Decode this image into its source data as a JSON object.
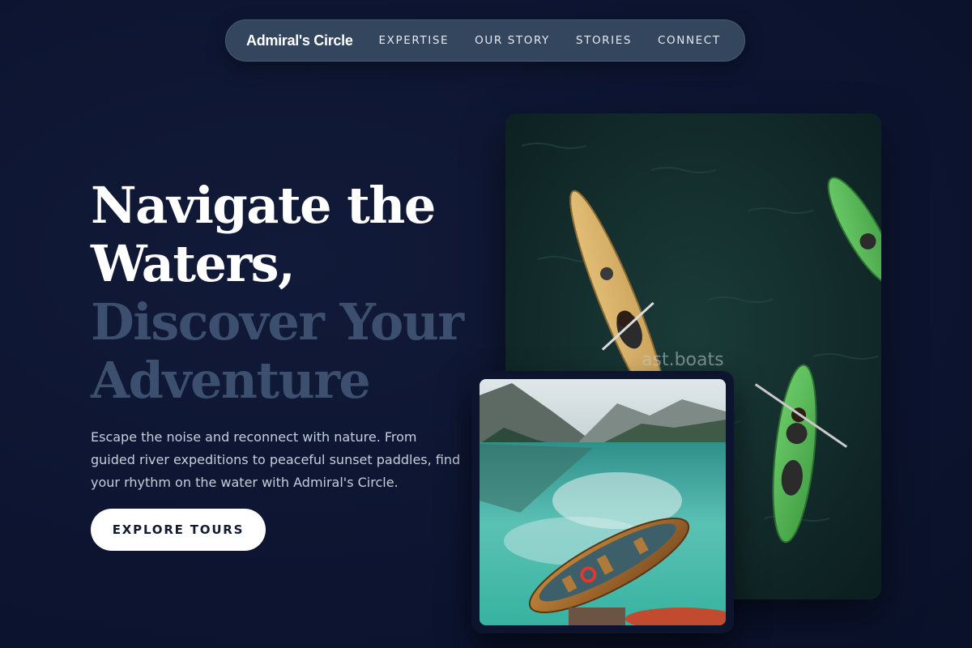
{
  "nav": {
    "brand": "Admiral's Circle",
    "links": [
      "EXPERTISE",
      "OUR STORY",
      "STORIES",
      "CONNECT"
    ]
  },
  "hero": {
    "headline_line1": "Navigate the",
    "headline_line2": "Waters,",
    "headline_line3": "Discover Your",
    "headline_line4": "Adventure",
    "description": "Escape the noise and reconnect with nature. From guided river expeditions to peaceful sunset paddles, find your rhythm on the water with Admiral's Circle.",
    "cta_label": "EXPLORE TOURS"
  },
  "images": {
    "main_photo_watermark": "ast.boats"
  },
  "colors": {
    "background": "#0d1530",
    "nav_pill": "#34455e",
    "headline_light": "#ffffff",
    "headline_muted": "#3c4f6e",
    "body_text": "#c6cedb",
    "cta_bg": "#ffffff",
    "cta_text": "#121a2e"
  }
}
